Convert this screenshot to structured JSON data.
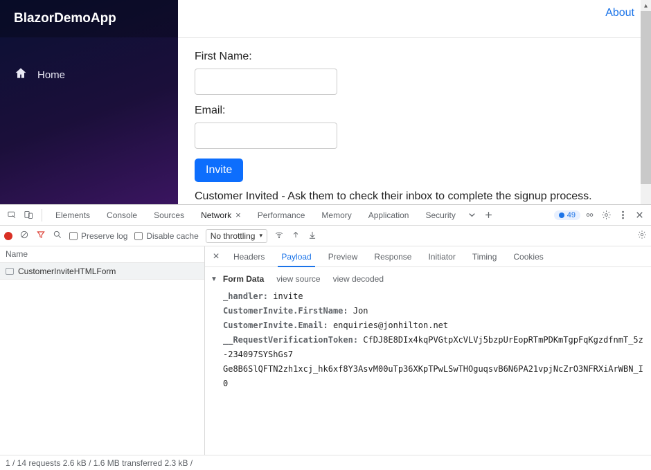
{
  "app": {
    "brand": "BlazorDemoApp",
    "nav": {
      "home": "Home"
    },
    "top_link": "About",
    "form": {
      "first_name_label": "First Name:",
      "email_label": "Email:",
      "invite_button": "Invite",
      "status": "Customer Invited - Ask them to check their inbox to complete the signup process."
    }
  },
  "devtools": {
    "tabs": {
      "elements": "Elements",
      "console": "Console",
      "sources": "Sources",
      "network": "Network",
      "performance": "Performance",
      "memory": "Memory",
      "application": "Application",
      "security": "Security"
    },
    "issues_count": "49",
    "toolbar": {
      "preserve_log": "Preserve log",
      "disable_cache": "Disable cache",
      "throttling": "No throttling"
    },
    "request_list": {
      "header": "Name",
      "items": [
        "CustomerInviteHTMLForm"
      ]
    },
    "detail_tabs": {
      "headers": "Headers",
      "payload": "Payload",
      "preview": "Preview",
      "response": "Response",
      "initiator": "Initiator",
      "timing": "Timing",
      "cookies": "Cookies"
    },
    "payload": {
      "section_title": "Form Data",
      "view_source": "view source",
      "view_decoded": "view decoded",
      "rows": {
        "_handler": {
          "k": "_handler",
          "v": "invite"
        },
        "firstName": {
          "k": "CustomerInvite.FirstName",
          "v": "Jon"
        },
        "email": {
          "k": "CustomerInvite.Email",
          "v": "enquiries@jonhilton.net"
        },
        "token": {
          "k": "__RequestVerificationToken",
          "v1": "CfDJ8E8DIx4kqPVGtpXcVLVj5bzpUrEopRTmPDKmTgpFqKgzdfnmT_5z-234097SYShGs7",
          "v2": "Ge8B6SlQFTN2zh1xcj_hk6xf8Y3AsvM00uTp36XKpTPwLSwTHOguqsvB6N6PA21vpjNcZrO3NFRXiArWBN_I0"
        }
      }
    },
    "statusbar": "1 / 14 requests   2.6 kB / 1.6 MB transferred   2.3 kB /"
  }
}
